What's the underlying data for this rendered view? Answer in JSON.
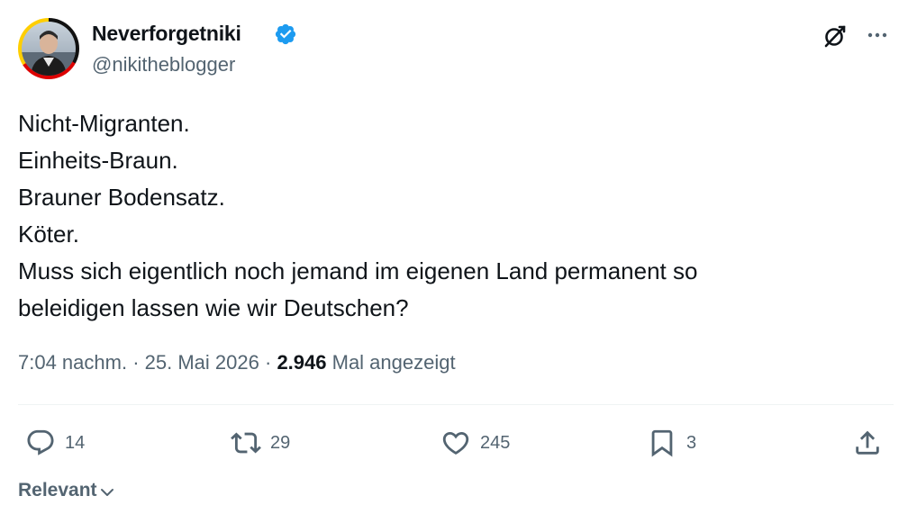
{
  "author": {
    "display_name": "Neverforgetniki",
    "handle": "@nikitheblogger",
    "verified": true,
    "avatar_ring_colors": [
      "#111111",
      "#dd0000",
      "#ffce00"
    ]
  },
  "tweet": {
    "lines": [
      "Nicht-Migranten.",
      "Einheits-Braun.",
      "Brauner Bodensatz.",
      "Köter.",
      "Muss sich eigentlich noch jemand im eigenen Land permanent so",
      "beleidigen lassen wie wir Deutschen?"
    ]
  },
  "meta": {
    "time": "7:04 nachm.",
    "separator": "·",
    "date": "25. Mai 2026",
    "views_count": "2.946",
    "views_label": "Mal angezeigt"
  },
  "actions": {
    "replies": "14",
    "reposts": "29",
    "likes": "245",
    "bookmarks": "3"
  },
  "sort": {
    "label": "Relevant"
  },
  "colors": {
    "text": "#0f1419",
    "secondary": "#536471",
    "verified": "#1d9bf0",
    "divider": "#eff3f4"
  }
}
